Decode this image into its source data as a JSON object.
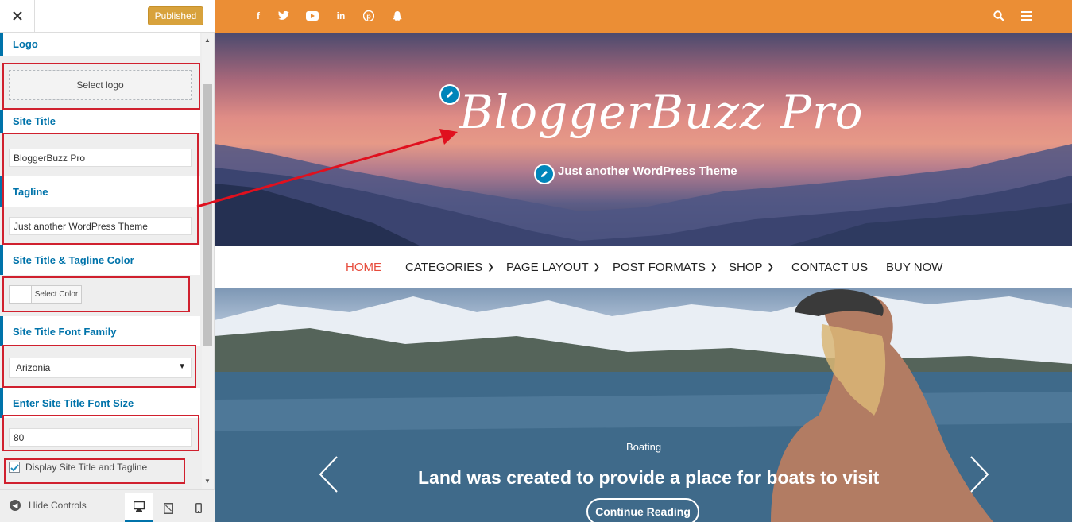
{
  "customizer": {
    "publish_label": "Published",
    "logo_label": "Logo",
    "select_logo": "Select logo",
    "site_title_label": "Site Title",
    "site_title_value": "BloggerBuzz Pro",
    "tagline_label": "Tagline",
    "tagline_value": "Just another WordPress Theme",
    "color_label": "Site Title & Tagline Color",
    "select_color": "Select Color",
    "font_family_label": "Site Title Font Family",
    "font_family_value": "Arizonia",
    "font_size_label": "Enter Site Title Font Size",
    "font_size_value": "80",
    "display_checkbox_label": "Display Site Title and Tagline",
    "display_checkbox_checked": true,
    "hide_controls": "Hide Controls"
  },
  "preview": {
    "social_icons": [
      "facebook-icon",
      "twitter-icon",
      "youtube-icon",
      "linkedin-icon",
      "pinterest-icon",
      "snapchat-icon"
    ],
    "site_title": "BloggerBuzz Pro",
    "tagline": "Just another WordPress Theme",
    "nav": [
      "HOME",
      "CATEGORIES",
      "PAGE LAYOUT",
      "POST FORMATS",
      "SHOP",
      "CONTACT US",
      "BUY NOW"
    ],
    "slide": {
      "category": "Boating",
      "title": "Land was created to provide a place for boats to visit",
      "cta": "Continue Reading"
    }
  },
  "colors": {
    "accent": "#0073aa",
    "topbar": "#eb8e35",
    "publish": "#d8a23c",
    "highlight": "#d0202e",
    "nav_active": "#e74c3c"
  }
}
